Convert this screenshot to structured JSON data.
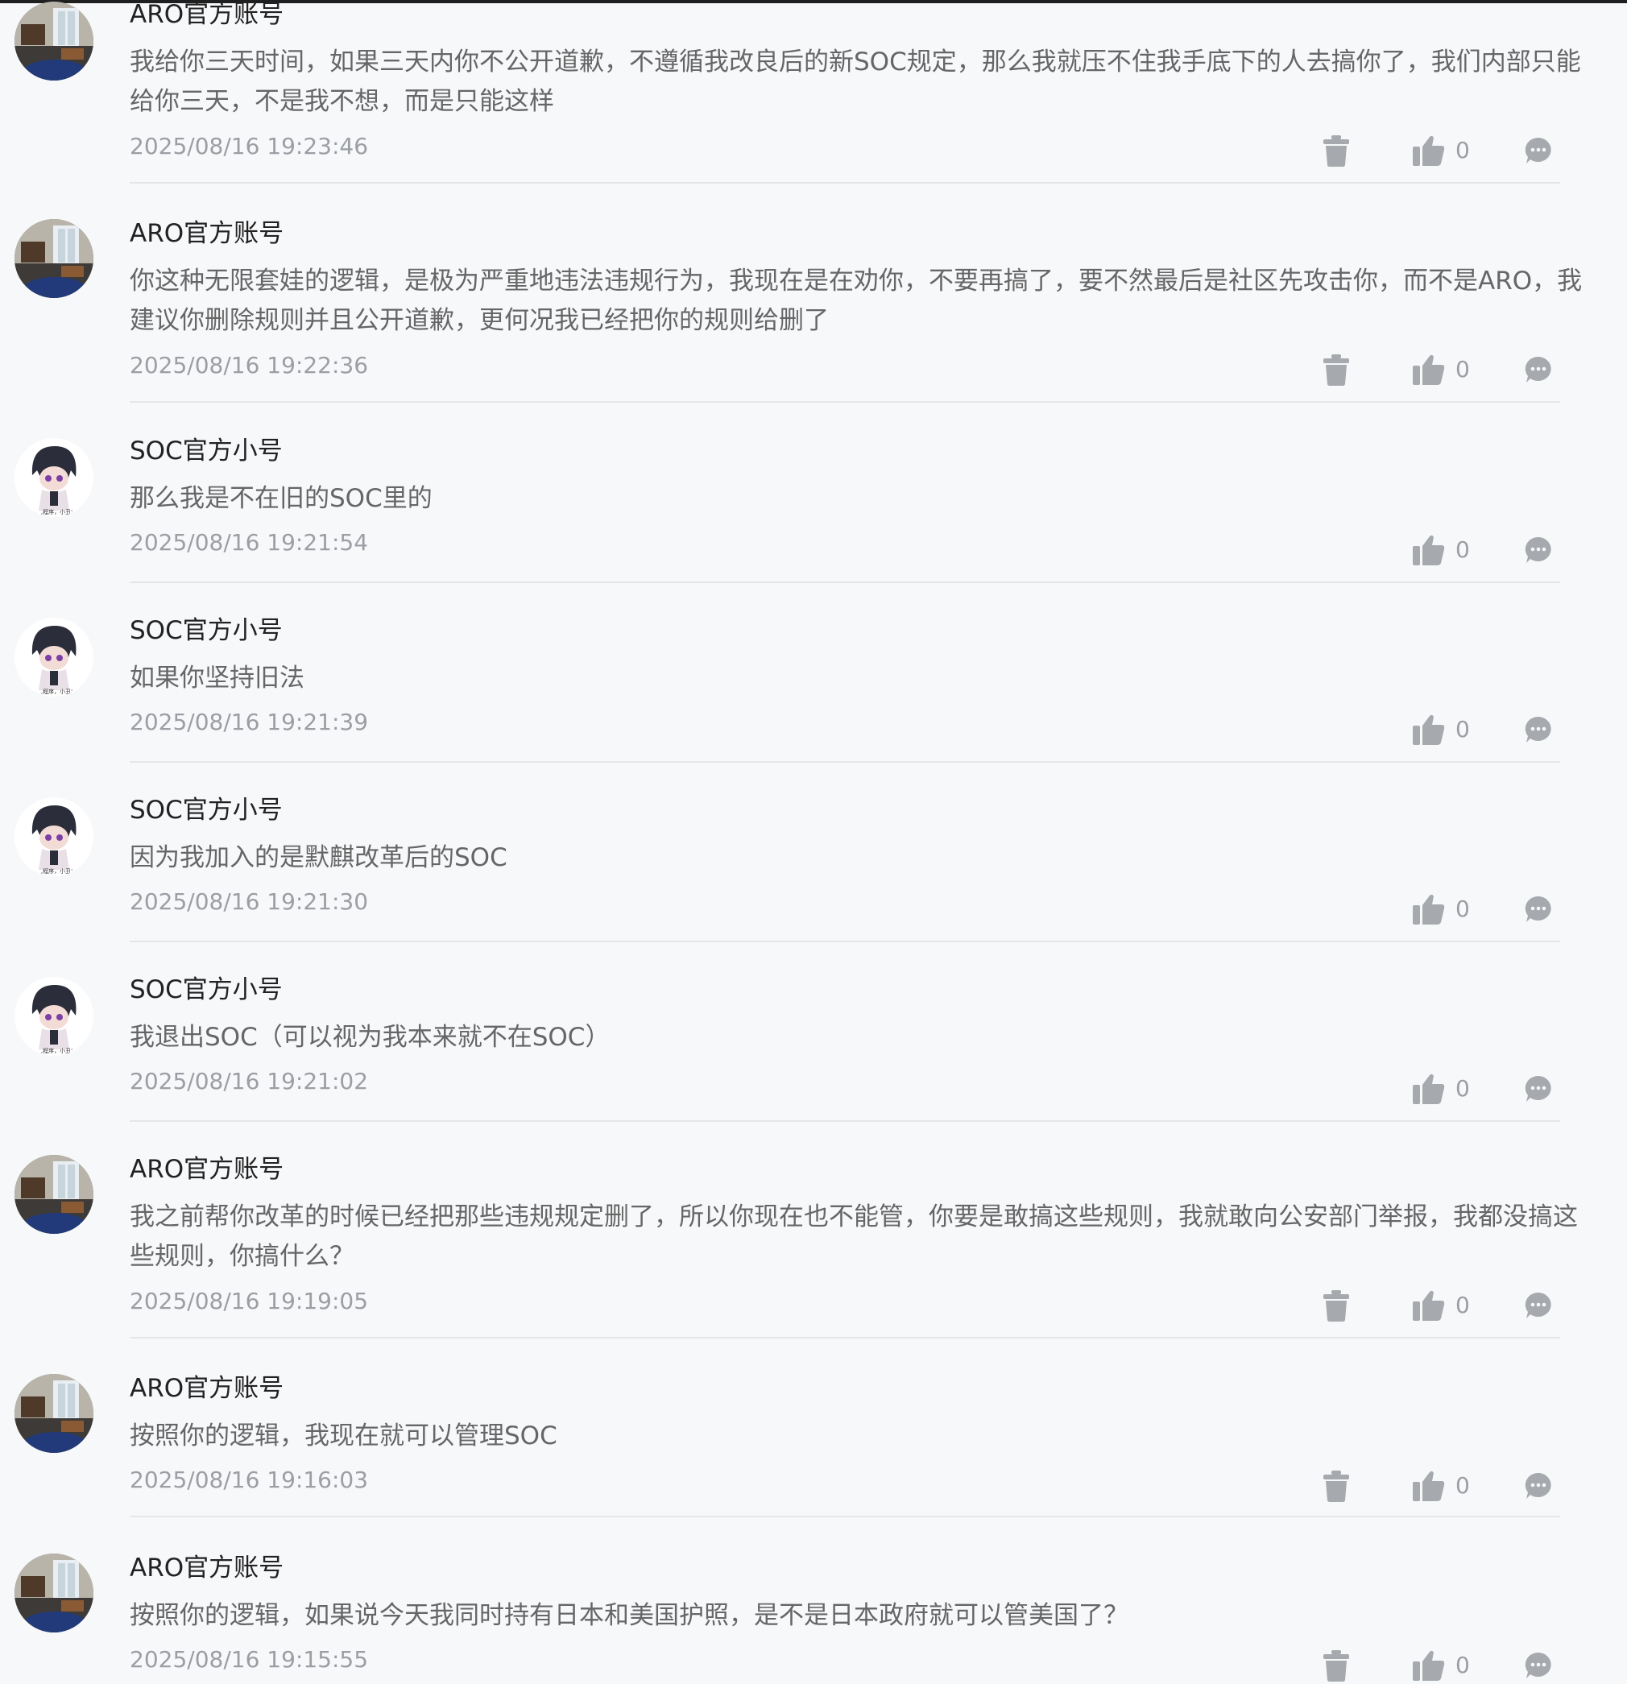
{
  "comments": [
    {
      "user": "ARO官方账号",
      "avatar": "room-photo-avatar",
      "text": "我给你三天时间，如果三天内你不公开道歉，不遵循我改良后的新SOC规定，那么我就压不住我手底下的人去搞你了，我们内部只能给你三天，不是我不想，而是只能这样",
      "time": "2025/08/16 19:23:46",
      "likes": "0",
      "can_delete": true
    },
    {
      "user": "ARO官方账号",
      "avatar": "room-photo-avatar",
      "text": "你这种无限套娃的逻辑，是极为严重地违法违规行为，我现在是在劝你，不要再搞了，要不然最后是社区先攻击你，而不是ARO，我建议你删除规则并且公开道歉，更何况我已经把你的规则给删了",
      "time": "2025/08/16 19:22:36",
      "likes": "0",
      "can_delete": true
    },
    {
      "user": "SOC官方小号",
      "avatar": "anime-character-avatar",
      "text": "那么我是不在旧的SOC里的",
      "time": "2025/08/16 19:21:54",
      "likes": "0",
      "can_delete": false
    },
    {
      "user": "SOC官方小号",
      "avatar": "anime-character-avatar",
      "text": "如果你坚持旧法",
      "time": "2025/08/16 19:21:39",
      "likes": "0",
      "can_delete": false
    },
    {
      "user": "SOC官方小号",
      "avatar": "anime-character-avatar",
      "text": "因为我加入的是默麒改革后的SOC",
      "time": "2025/08/16 19:21:30",
      "likes": "0",
      "can_delete": false
    },
    {
      "user": "SOC官方小号",
      "avatar": "anime-character-avatar",
      "text": "我退出SOC（可以视为我本来就不在SOC）",
      "time": "2025/08/16 19:21:02",
      "likes": "0",
      "can_delete": false
    },
    {
      "user": "ARO官方账号",
      "avatar": "room-photo-avatar",
      "text": "我之前帮你改革的时候已经把那些违规规定删了，所以你现在也不能管，你要是敢搞这些规则，我就敢向公安部门举报，我都没搞这些规则，你搞什么？",
      "time": "2025/08/16 19:19:05",
      "likes": "0",
      "can_delete": true
    },
    {
      "user": "ARO官方账号",
      "avatar": "room-photo-avatar",
      "text": "按照你的逻辑，我现在就可以管理SOC",
      "time": "2025/08/16 19:16:03",
      "likes": "0",
      "can_delete": true
    },
    {
      "user": "ARO官方账号",
      "avatar": "room-photo-avatar",
      "text": "按照你的逻辑，如果说今天我同时持有日本和美国护照，是不是日本政府就可以管美国了？",
      "time": "2025/08/16 19:15:55",
      "likes": "0",
      "can_delete": true
    }
  ],
  "colors": {
    "background": "#f7f8fa",
    "username": "#222222",
    "content": "#666666",
    "meta": "#9b9ea3",
    "divider": "#e4e6e9",
    "icon": "#a6a9ad"
  },
  "icons": {
    "delete": "trash-icon",
    "like": "thumbs-up-icon",
    "reply": "comment-bubble-icon"
  }
}
